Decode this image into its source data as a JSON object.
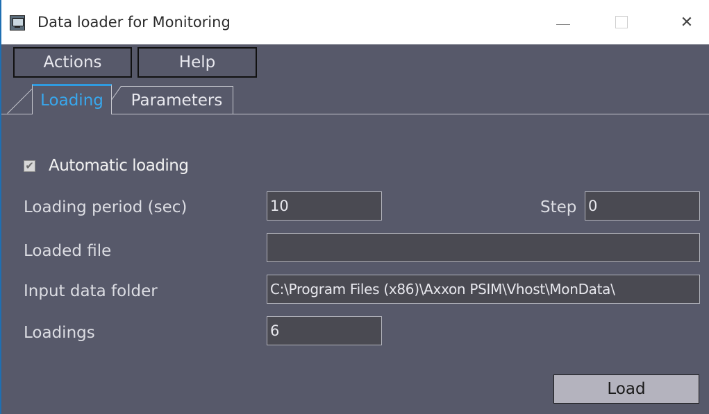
{
  "window": {
    "title": "Data loader for Monitoring",
    "app_icon": "monitor-icon",
    "controls": {
      "minimize": "minimize-icon",
      "maximize": "maximize-icon",
      "close": "close-icon",
      "close_glyph": "✕"
    }
  },
  "menu": {
    "actions_label": "Actions",
    "help_label": "Help"
  },
  "tabs": [
    {
      "label": "Loading",
      "active": true
    },
    {
      "label": "Parameters",
      "active": false
    }
  ],
  "loading_tab": {
    "automatic_loading": {
      "label": "Automatic loading",
      "checked": true,
      "check_glyph": "✔"
    },
    "loading_period": {
      "label": "Loading period (sec)",
      "value": "10"
    },
    "step": {
      "label": "Step",
      "value": "0"
    },
    "loaded_file": {
      "label": "Loaded file",
      "value": ""
    },
    "input_folder": {
      "label": "Input data folder",
      "value": "C:\\Program Files (x86)\\Axxon PSIM\\Vhost\\MonData\\"
    },
    "loadings": {
      "label": "Loadings",
      "value": "6"
    },
    "load_button": "Load"
  },
  "colors": {
    "client_bg": "#57596a",
    "active_tab_text": "#38a8ee",
    "field_bg": "#4a4a52",
    "button_bg": "#b4b3be"
  }
}
